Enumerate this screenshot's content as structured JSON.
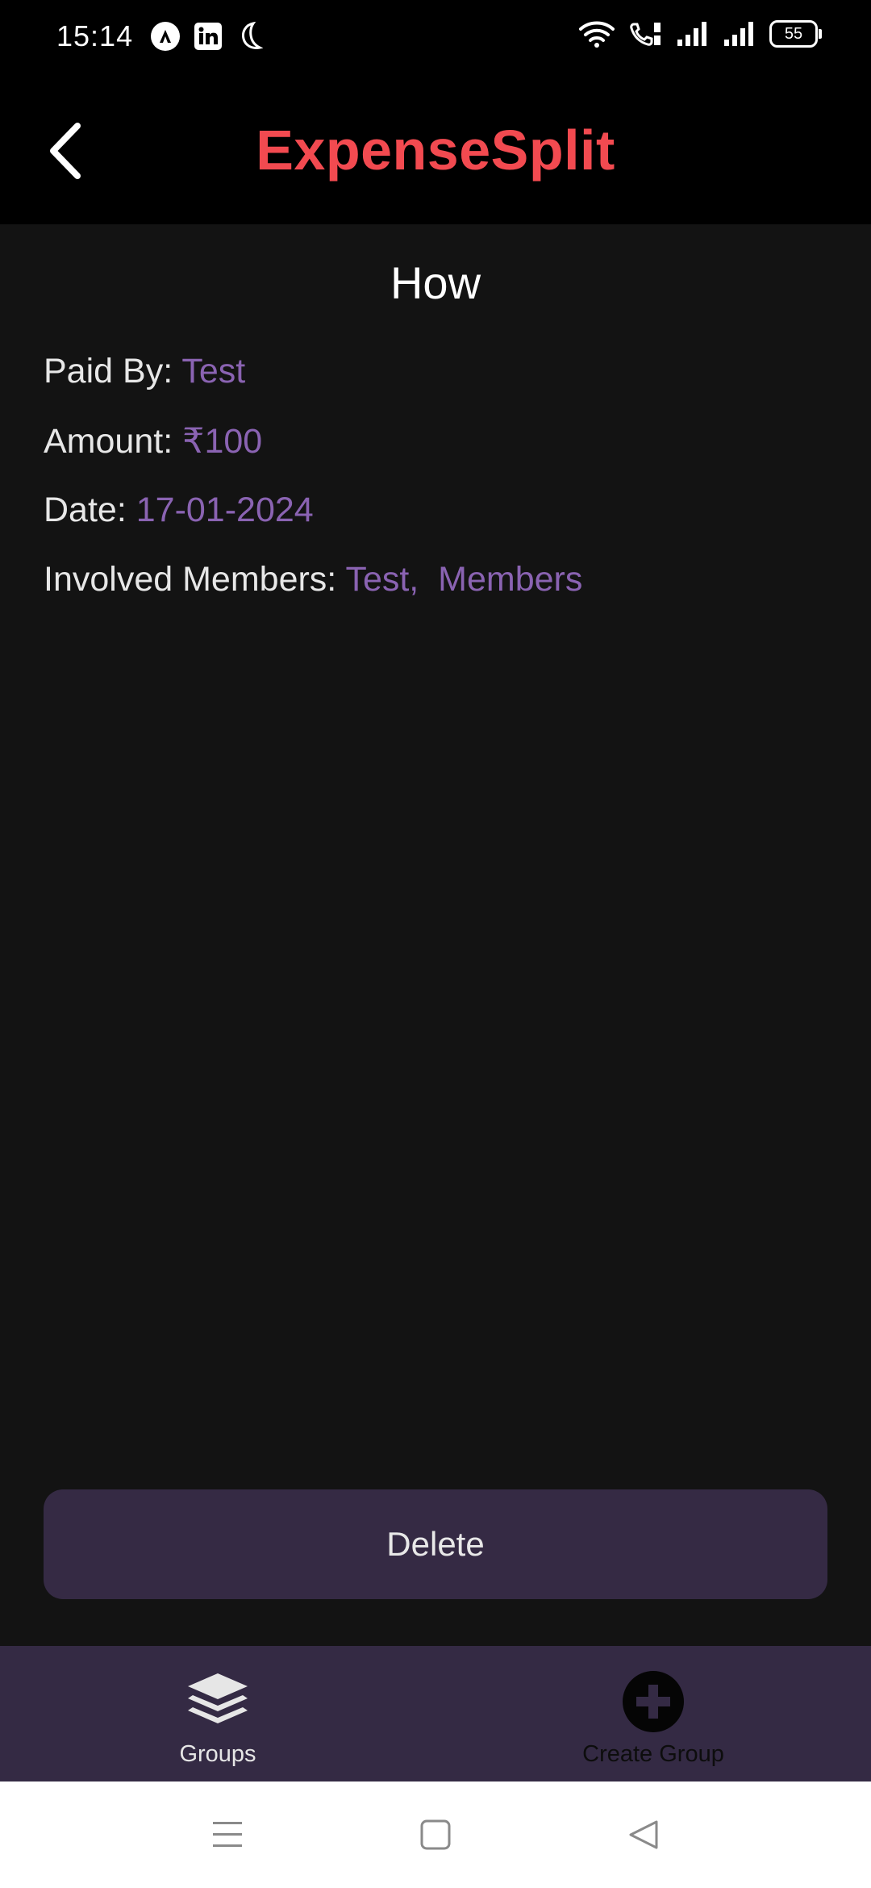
{
  "status_bar": {
    "time": "15:14",
    "battery": "55",
    "icons": [
      "app-notification-icon",
      "linkedin-icon",
      "do-not-disturb-icon",
      "wifi-icon",
      "call-icon",
      "signal-icon",
      "signal-icon"
    ]
  },
  "header": {
    "title": "ExpenseSplit",
    "title_color": "#f24a50"
  },
  "expense": {
    "title": "How",
    "paid_by_label": "Paid By:",
    "paid_by_value": "Test",
    "amount_label": "Amount:",
    "amount_value": "₹100",
    "date_label": "Date:",
    "date_value": "17-01-2024",
    "members_label": "Involved Members:",
    "members_value": "Test,  Members",
    "value_color": "#8a63b2"
  },
  "actions": {
    "delete_label": "Delete"
  },
  "bottom_nav": {
    "items": [
      {
        "label": "Groups",
        "icon": "layers-icon"
      },
      {
        "label": "Create Group",
        "icon": "add-circle-icon"
      }
    ]
  },
  "system_nav": {
    "buttons": [
      "menu-icon",
      "home-icon",
      "back-triangle-icon"
    ]
  }
}
